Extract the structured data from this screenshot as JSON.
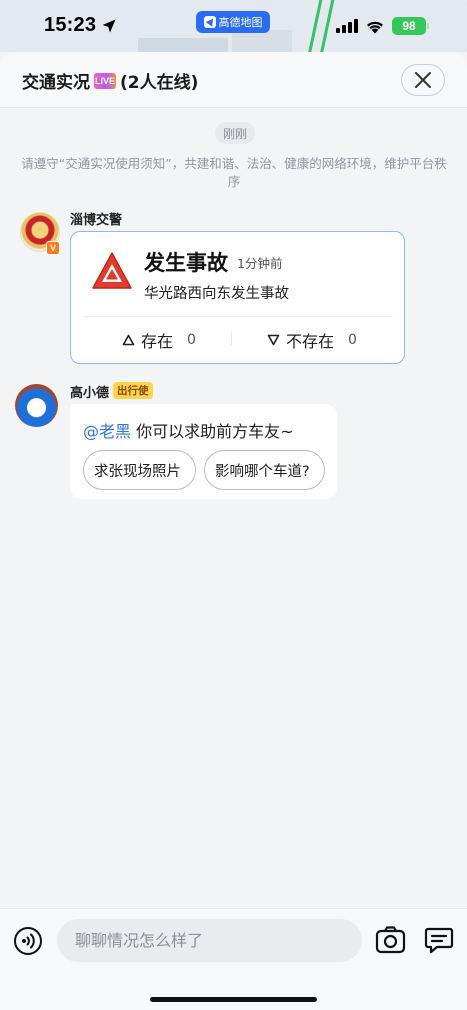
{
  "status_bar": {
    "time": "15:23",
    "app_pill_label": "高德地图",
    "battery": "98"
  },
  "header": {
    "title": "交通实况",
    "live_badge": "LIVE",
    "online_count": "(2人在线)"
  },
  "chat": {
    "time_chip": "刚刚",
    "notice": "请遵守“交通实况使用须知”，共建和谐、法治、健康的网络环境，维护平台秩序",
    "messages": [
      {
        "sender": "淄博交警",
        "verified_badge": "V",
        "card": {
          "title": "发生事故",
          "time": "1分钟前",
          "description": "华光路西向东发生事故",
          "vote_yes_label": "存在",
          "vote_yes_count": "0",
          "vote_no_label": "不存在",
          "vote_no_count": "0"
        }
      },
      {
        "sender": "高小德",
        "tag": "出行使",
        "mention": "@老黑",
        "text": " 你可以求助前方车友~",
        "suggestions": [
          "求张现场照片",
          "影响哪个车道?"
        ]
      }
    ]
  },
  "input_bar": {
    "placeholder": "聊聊情况怎么样了"
  },
  "colors": {
    "accent_blue": "#2f74e6",
    "card_border": "#8bb8ff",
    "warning_red": "#e23a2e",
    "tag_yellow": "#ffd34d",
    "battery_green": "#34c759"
  },
  "icons": {
    "location": "location-arrow-icon",
    "signal": "cellular-signal-icon",
    "wifi": "wifi-icon",
    "close": "close-icon",
    "warning": "warning-triangle-icon",
    "vote_up": "triangle-up-icon",
    "vote_down": "triangle-down-icon",
    "voice": "voice-broadcast-icon",
    "camera": "camera-icon",
    "message": "message-icon"
  }
}
